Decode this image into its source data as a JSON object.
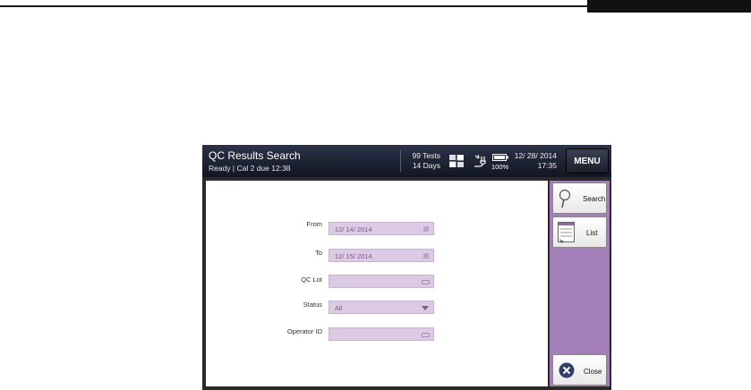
{
  "header": {
    "title": "QC Results Search",
    "status": "Ready | Cal 2 due  12:38",
    "tests_line1": "99 Tests",
    "tests_line2": "14 Days",
    "battery_pct": "100%",
    "date": "12/ 28/ 2014",
    "time": "17:35",
    "menu_label": "MENU"
  },
  "form": {
    "from_label": "From",
    "from_value": "12/ 14/ 2014",
    "to_label": "To",
    "to_value": "12/ 15/ 2014",
    "qclot_label": "QC Lot",
    "qclot_value": "",
    "status_label": "Status",
    "status_value": "All",
    "operator_label": "Operator ID",
    "operator_value": ""
  },
  "side": {
    "search_label": "Search",
    "list_label": "List",
    "close_label": "Close"
  },
  "icons": [
    "connection-grid-icon",
    "power-plug-icon",
    "battery-icon",
    "calendar-icon",
    "keyboard-icon",
    "dropdown-arrow-icon",
    "magnifier-icon",
    "list-icon",
    "close-x-icon"
  ],
  "colors": {
    "panel_purple": "#a27fb9",
    "field_purple": "#dcc9e3",
    "title_bar": "#161a26"
  }
}
